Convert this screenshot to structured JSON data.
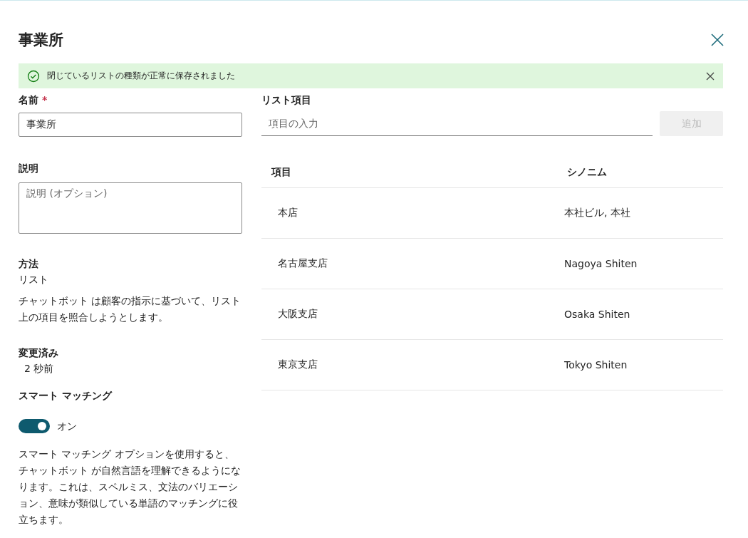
{
  "panel": {
    "title": "事業所"
  },
  "banner": {
    "message": "閉じているリストの種類が正常に保存されました"
  },
  "name_field": {
    "label": "名前",
    "required_mark": "*",
    "value": "事業所"
  },
  "description_field": {
    "label": "説明",
    "placeholder": "説明 (オプション)"
  },
  "method": {
    "label": "方法",
    "value": "リスト",
    "description": "チャットボット は顧客の指示に基づいて、リスト上の項目を照合しようとします。"
  },
  "modified": {
    "label": "変更済み",
    "value": "2 秒前"
  },
  "smart_matching": {
    "label": "スマート マッチング",
    "on": true,
    "state_label": "オン",
    "description": "スマート マッチング オプションを使用すると、チャットボット が自然言語を理解できるようになります。これは、スペルミス、文法のバリエーション、意味が類似している単語のマッチングに役立ちます。"
  },
  "list_items": {
    "label": "リスト項目",
    "placeholder": "項目の入力",
    "add_button": {
      "label": "追加",
      "disabled": true
    }
  },
  "table": {
    "columns": [
      "項目",
      "シノニム"
    ],
    "rows": [
      [
        "本店",
        "本社ビル, 本社"
      ],
      [
        "名古屋支店",
        "Nagoya Shiten"
      ],
      [
        "大阪支店",
        "Osaka Shiten"
      ],
      [
        "東京支店",
        "Tokyo Shiten"
      ]
    ]
  }
}
